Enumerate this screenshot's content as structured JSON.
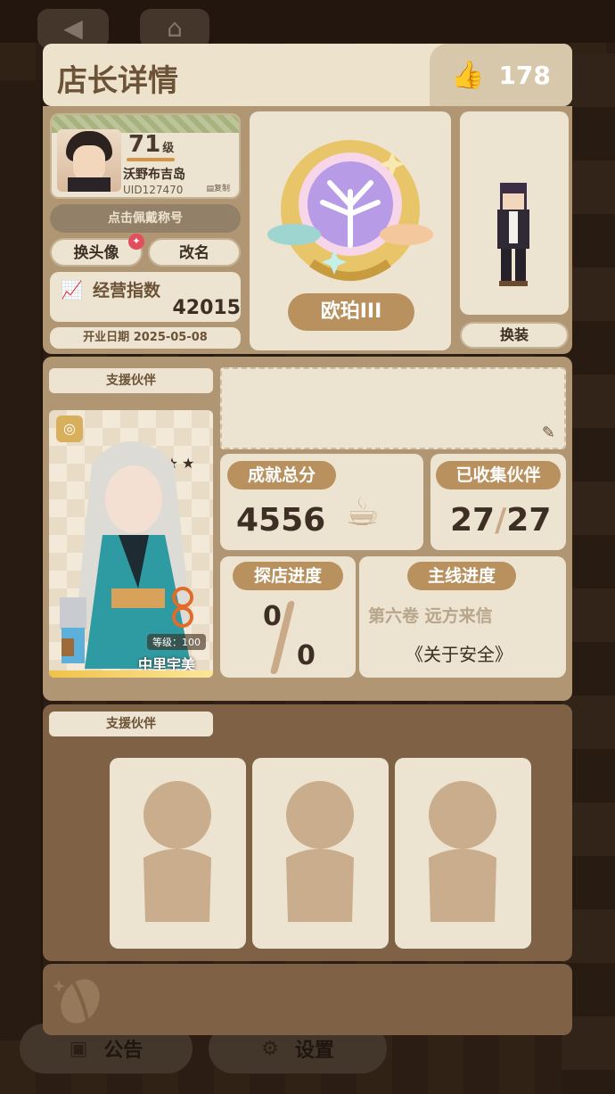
{
  "background": {
    "top_buttons": [
      "◀",
      "⌂"
    ]
  },
  "header": {
    "title": "店长详情",
    "likes": "178"
  },
  "profile": {
    "level": "71",
    "level_unit": "级",
    "name": "沃野布吉岛",
    "uid": "UID127470",
    "copy_label": "复制",
    "wear_title_label": "点击佩戴称号",
    "change_avatar_label": "换头像",
    "rename_label": "改名",
    "manage_index_label": "经营指数",
    "manage_index_value": "42015",
    "open_date_label": "开业日期",
    "open_date_value": "2025-05-08"
  },
  "badge": {
    "name": "欧珀III"
  },
  "character": {
    "outfit_label": "换装"
  },
  "support_partner": {
    "section_label": "支援伙伴",
    "name": "中里宇美",
    "level_text": "等级：100",
    "stars": "★★★★"
  },
  "stats": {
    "achievement_label": "成就总分",
    "achievement_value": "4556",
    "collected_label": "已收集伙伴",
    "collected_value": "27",
    "collected_total": "27",
    "explore_label": "探店进度",
    "explore_top": "0",
    "explore_bottom": "0",
    "mainline_label": "主线进度",
    "mainline_chapter": "第六卷 远方来信",
    "mainline_title": "《关于安全》"
  },
  "support_partners_2": {
    "section_label": "支援伙伴"
  },
  "bottom": {
    "notice_label": "公告",
    "settings_label": "设置"
  },
  "colors": {
    "panel_bg": "#ede2cc",
    "section_bg": "#b19674",
    "accent": "#b9915f",
    "dark_text": "#3d2f23"
  }
}
